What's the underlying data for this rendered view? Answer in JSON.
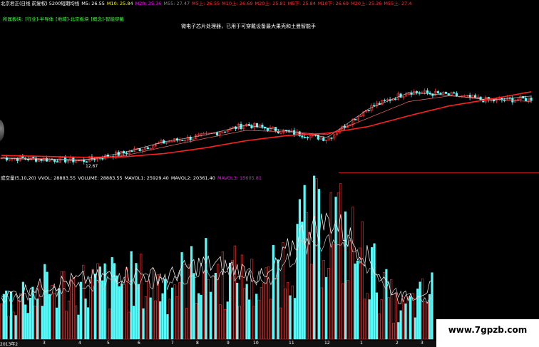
{
  "header": {
    "indicators": [
      {
        "text": "北京君正(日线 前复权) 5200短期均线",
        "color": "#ffffff"
      },
      {
        "text": "M5: 26.55",
        "color": "#ffffff"
      },
      {
        "text": "M10: 25.84",
        "color": "#ffff00"
      },
      {
        "text": "M20: 25.36",
        "color": "#ff00ff"
      },
      {
        "text": "M55: 27.47",
        "color": "#808080"
      },
      {
        "text": "M5上: 26.55",
        "color": "#ff3030"
      },
      {
        "text": "M10上: 26.69",
        "color": "#ff3030"
      },
      {
        "text": "M20上: 25.81",
        "color": "#ff3030"
      },
      {
        "text": "M5下: 25.84",
        "color": "#ff3030"
      },
      {
        "text": "M10下: 26.69",
        "color": "#ff3030"
      },
      {
        "text": "M20上: 25.36",
        "color": "#ff3030"
      },
      {
        "text": "M55上: 27.4",
        "color": "#ff3030"
      }
    ]
  },
  "sector_line": [
    "所属板块:",
    "[行业]-半导体",
    "[地域]-北京板块",
    "[概念]-智能穿戴"
  ],
  "notice": "微电子芯片处理器，已用于可穿戴设备最大果壳和土曼智能手",
  "main_chart": {
    "low_label": "12.67"
  },
  "volume_header": {
    "items": [
      {
        "text": "成交量(5,10,20)",
        "color": "#ffffff"
      },
      {
        "text": "VVOL: 28883.55",
        "color": "#ffffff"
      },
      {
        "text": "VOLUME: 28883.55",
        "color": "#ffffff"
      },
      {
        "text": "MAVOL1: 25929.40",
        "color": "#ffffff"
      },
      {
        "text": "MAVOL2: 20361.40",
        "color": "#ffffff"
      },
      {
        "text": "MAVOL3: 15605.81",
        "color": "#ff00ff"
      }
    ]
  },
  "date_axis": [
    "2013年2",
    "3",
    "4",
    "5",
    "6",
    "7",
    "8",
    "9",
    "10",
    "11",
    "12",
    "1",
    "2",
    "3"
  ],
  "watermark": "www.7gpzb.com",
  "colors": {
    "up": "#ff3232",
    "down": "#54fcfc",
    "ma_red": "#ff2020",
    "ma_white": "#ffffff"
  },
  "chart_data": [
    {
      "type": "candlestick",
      "title": "北京君正(日线 前复权)",
      "x": [
        "2013年2",
        "3",
        "4",
        "5",
        "6",
        "7",
        "8",
        "9",
        "10",
        "11",
        "12",
        "1",
        "2",
        "3"
      ],
      "close_trend": [
        13.5,
        13.2,
        12.9,
        14.5,
        16.8,
        18.2,
        20.5,
        19.0,
        17.5,
        24.0,
        27.5,
        26.8,
        25.6,
        26.0
      ],
      "series": [
        {
          "name": "M5",
          "values": [
            13.4,
            13.1,
            12.9,
            14.6,
            16.9,
            18.3,
            20.4,
            19.2,
            17.8,
            23.8,
            27.3,
            26.7,
            25.7,
            26.55
          ]
        },
        {
          "name": "M20",
          "values": [
            13.5,
            13.3,
            13.1,
            13.9,
            15.8,
            17.6,
            19.3,
            19.0,
            18.4,
            21.9,
            25.4,
            26.6,
            26.0,
            25.36
          ]
        },
        {
          "name": "M55",
          "values": [
            14.0,
            13.8,
            13.6,
            13.7,
            14.4,
            15.6,
            17.1,
            18.2,
            18.7,
            20.1,
            22.4,
            24.5,
            25.9,
            27.47
          ]
        }
      ],
      "annotations": [
        "12.67"
      ]
    },
    {
      "type": "bar",
      "title": "成交量(5,10,20)",
      "x": [
        "2013年2",
        "3",
        "4",
        "5",
        "6",
        "7",
        "8",
        "9",
        "10",
        "11",
        "12",
        "1",
        "2",
        "3"
      ],
      "series": [
        {
          "name": "VOLUME",
          "values": [
            23000,
            30000,
            32000,
            34000,
            36000,
            33000,
            42000,
            39000,
            32000,
            61000,
            72000,
            48000,
            17000,
            28883.55
          ]
        },
        {
          "name": "MAVOL1",
          "values": [
            21000,
            26000,
            29000,
            31000,
            33000,
            31000,
            38000,
            36000,
            30000,
            52000,
            60000,
            42000,
            20000,
            25929.4
          ]
        },
        {
          "name": "MAVOL2",
          "values": [
            19000,
            23000,
            26000,
            28000,
            30000,
            29000,
            34000,
            33000,
            29000,
            45000,
            52000,
            38000,
            21000,
            20361.4
          ]
        }
      ]
    }
  ]
}
